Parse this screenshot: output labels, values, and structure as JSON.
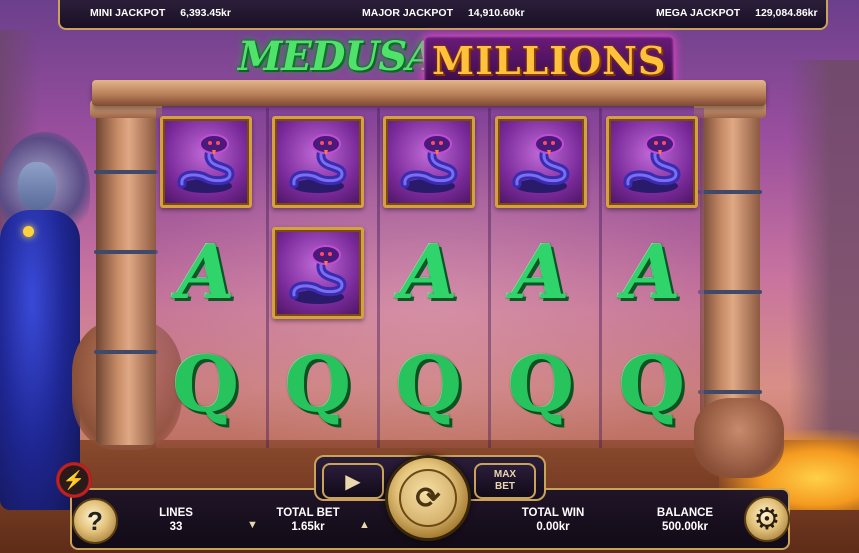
{
  "jackpots": {
    "mini": {
      "label": "MINI JACKPOT",
      "value": "6,393.45kr"
    },
    "major": {
      "label": "MAJOR JACKPOT",
      "value": "14,910.60kr"
    },
    "mega": {
      "label": "MEGA JACKPOT",
      "value": "129,084.86kr"
    }
  },
  "logo": {
    "word1": "MEDUSA'S",
    "word2": "MILLIONS"
  },
  "reels": [
    [
      "cobra",
      "A",
      "Q"
    ],
    [
      "cobra",
      "cobra",
      "Q"
    ],
    [
      "cobra",
      "A",
      "Q"
    ],
    [
      "cobra",
      "A",
      "Q"
    ],
    [
      "cobra",
      "A",
      "Q"
    ]
  ],
  "symbols": {
    "A": "A",
    "Q": "Q"
  },
  "controls": {
    "lines_label": "LINES",
    "lines_value": "33",
    "bet_label": "TOTAL BET",
    "bet_value": "1.65kr",
    "win_label": "TOTAL WIN",
    "win_value": "0.00kr",
    "balance_label": "BALANCE",
    "balance_value": "500.00kr",
    "max_bet_line1": "MAX",
    "max_bet_line2": "BET",
    "help_glyph": "?",
    "play_glyph": "▶",
    "spin_glyph": "⟳",
    "settings_glyph": "⚙",
    "turbo_glyph": "⚡",
    "bet_down_glyph": "▼",
    "bet_up_glyph": "▲"
  },
  "icons": {
    "help": "help-icon",
    "play": "play-icon",
    "spin": "spin-icon",
    "settings": "gear-icon",
    "turbo": "lightning-icon"
  },
  "colors": {
    "gold": "#c9a35a",
    "symbol_green": "#2fd46a",
    "cobra_purple": "#7a2a9a"
  }
}
